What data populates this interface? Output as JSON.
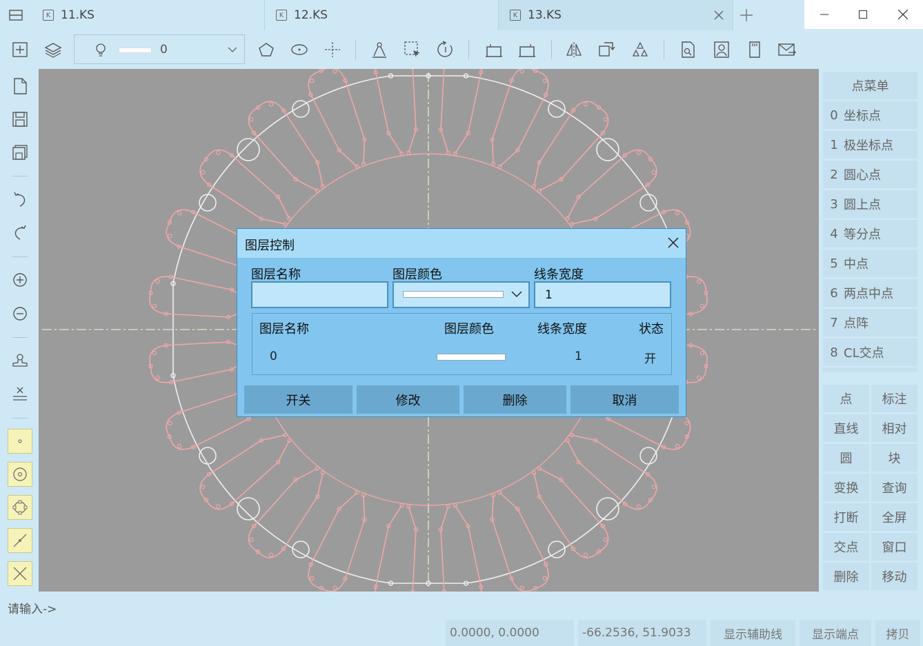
{
  "tabs": [
    {
      "label": "11.KS",
      "icon": "ks-file-icon"
    },
    {
      "label": "12.KS",
      "icon": "ks-file-icon"
    },
    {
      "label": "13.KS",
      "icon": "ks-file-icon",
      "active": true
    }
  ],
  "toolbar": {
    "layer_value": "0"
  },
  "right_panel": {
    "title": "点菜单",
    "point_items": [
      {
        "num": "0",
        "label": "坐标点"
      },
      {
        "num": "1",
        "label": "极坐标点"
      },
      {
        "num": "2",
        "label": "圆心点"
      },
      {
        "num": "3",
        "label": "圆上点"
      },
      {
        "num": "4",
        "label": "等分点"
      },
      {
        "num": "5",
        "label": "中点"
      },
      {
        "num": "6",
        "label": "两点中点"
      },
      {
        "num": "7",
        "label": "点阵"
      },
      {
        "num": "8",
        "label": "CL交点"
      }
    ],
    "buttons": [
      [
        "点",
        "标注"
      ],
      [
        "直线",
        "相对"
      ],
      [
        "圆",
        "块"
      ],
      [
        "变换",
        "查询"
      ],
      [
        "打断",
        "全屏"
      ],
      [
        "交点",
        "窗口"
      ],
      [
        "删除",
        "移动"
      ]
    ]
  },
  "status": {
    "prompt": "请输入->",
    "coord1": "0.0000, 0.0000",
    "coord2": "-66.2536, 51.9033",
    "btn_aux": "显示辅助线",
    "btn_end": "显示端点",
    "btn_copy": "拷贝"
  },
  "dialog": {
    "title": "图层控制",
    "label_name": "图层名称",
    "label_color": "图层颜色",
    "label_width": "线条宽度",
    "name_value": "",
    "width_value": "1",
    "table": {
      "headers": [
        "图层名称",
        "图层颜色",
        "线条宽度",
        "状态"
      ],
      "rows": [
        {
          "name": "0",
          "color": "#ffffff",
          "width": "1",
          "state": "开"
        }
      ]
    },
    "buttons": {
      "toggle": "开关",
      "modify": "修改",
      "delete": "删除",
      "cancel": "取消"
    }
  },
  "colors": {
    "background": "#cfe8f5",
    "canvas": "#9b9b9b",
    "drawing_lines": "#f0f0f0",
    "slot_lines": "#f0a7a7",
    "center_lines": "#cfe0c0",
    "dialog": "#82c5ee",
    "dialog_header": "#a8dcf8",
    "snap_buttons": "#f6f3b8"
  }
}
